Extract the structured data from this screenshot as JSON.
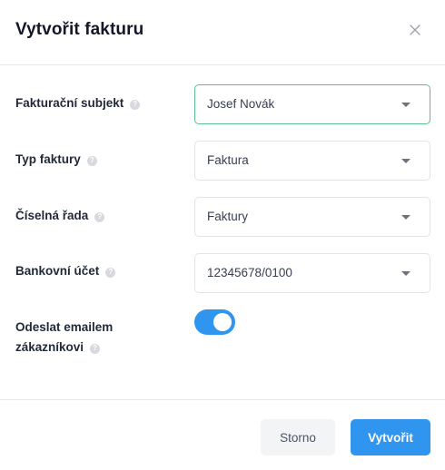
{
  "dialog": {
    "title": "Vytvořit fakturu",
    "close_icon": "close-icon"
  },
  "fields": [
    {
      "label": "Fakturační subjekt",
      "value": "Josef Novák"
    },
    {
      "label": "Typ faktury",
      "value": "Faktura"
    },
    {
      "label": "Číselná řada",
      "value": "Faktury"
    },
    {
      "label": "Bankovní účet",
      "value": "12345678/0100"
    }
  ],
  "email_toggle": {
    "label_line1": "Odeslat emailem",
    "label_line2": "zákazníkovi",
    "enabled": true
  },
  "help_glyph": "?",
  "buttons": {
    "cancel": "Storno",
    "create": "Vytvořit"
  },
  "colors": {
    "accent": "#2f95ee",
    "focus_border": "#5cc08a"
  }
}
